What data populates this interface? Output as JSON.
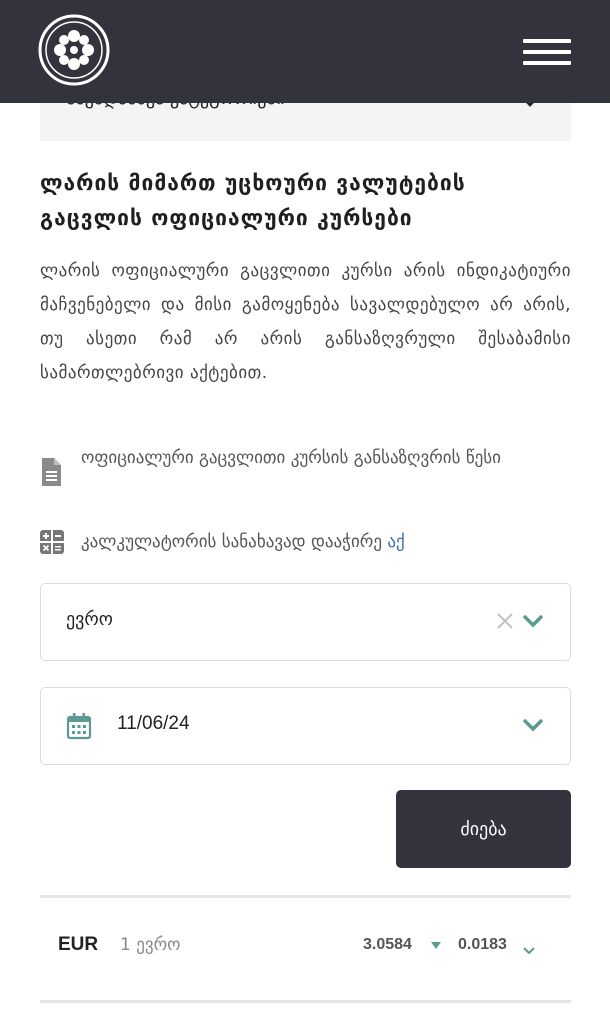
{
  "header": {
    "logo_icon": "flower-emblem-icon",
    "menu_icon": "hamburger-menu-icon",
    "background": "#32333d"
  },
  "collapsed_section": {
    "label": "სხვადასხვა კატეგორიები",
    "icon": "chevron-down-icon"
  },
  "page": {
    "title": "ლარის მიმართ უცხოური ვალუტების გაცვლის ოფიციალური კურსები",
    "description": "ლარის ოფიციალური გაცვლითი კურსი არის ინდიკატიური მაჩვენებელი და მისი გამოყენება სავალდებულო არ არის, თუ ასეთი რამ არ არის განსაზღვრული შესაბამისი სამართლებრივი აქტებით."
  },
  "links": {
    "rules_label": "ოფიციალური გაცვლითი კურსის განსაზღვრის წესი",
    "rules_icon": "document-icon",
    "calculator_label": "კალკულატორის სანახავად დააჭირე ",
    "calculator_link": "აქ",
    "calculator_icon": "calculator-icon"
  },
  "filters": {
    "currency_value": "ევრო",
    "date_value": "11/06/24",
    "date_icon": "calendar-icon",
    "search_label": "ძიება"
  },
  "results": [
    {
      "code": "EUR",
      "unit": "1 ევრო",
      "rate": "3.0584",
      "trend": "down",
      "change": "0.0183"
    }
  ],
  "colors": {
    "dark": "#32333d",
    "accent_teal": "#5b9b91",
    "link_blue": "#3f6f9f"
  }
}
